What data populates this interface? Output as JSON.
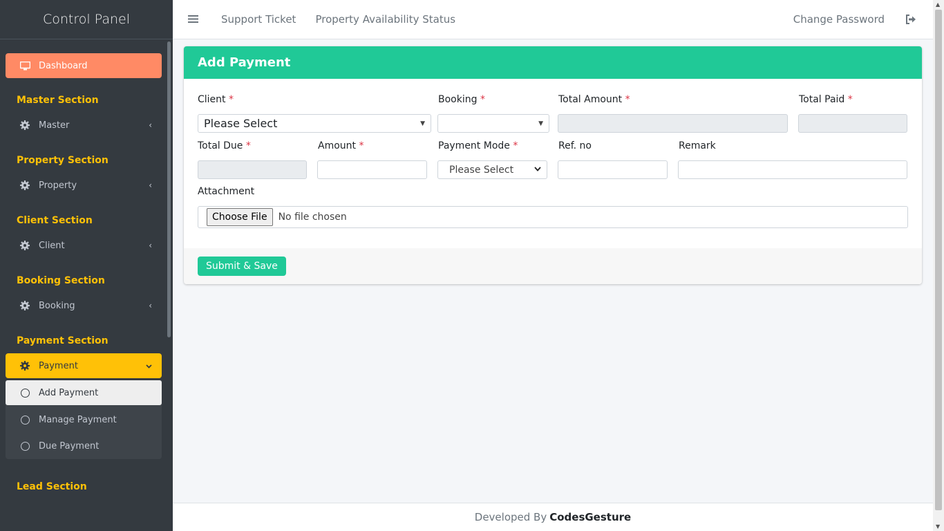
{
  "sidebar": {
    "brand": "Control Panel",
    "dashboard": "Dashboard",
    "sections": [
      {
        "header": "Master Section",
        "item": "Master"
      },
      {
        "header": "Property Section",
        "item": "Property"
      },
      {
        "header": "Client Section",
        "item": "Client"
      },
      {
        "header": "Booking Section",
        "item": "Booking"
      }
    ],
    "payment_header": "Payment Section",
    "payment_item": "Payment",
    "payment_sub": [
      "Add Payment",
      "Manage Payment",
      "Due Payment"
    ],
    "lead_header": "Lead Section"
  },
  "topnav": {
    "support": "Support Ticket",
    "availability": "Property Availability Status",
    "change_password": "Change Password"
  },
  "card": {
    "title": "Add Payment",
    "labels": {
      "client": "Client",
      "booking": "Booking",
      "total_amount": "Total Amount",
      "total_paid": "Total Paid",
      "total_due": "Total Due",
      "amount": "Amount",
      "payment_mode": "Payment Mode",
      "ref_no": "Ref. no",
      "remark": "Remark",
      "attachment": "Attachment"
    },
    "required_mark": "*",
    "client_value": "Please Select",
    "booking_value": "",
    "payment_mode_value": "Please Select",
    "file_button": "Choose File",
    "file_status": "No file chosen",
    "submit": "Submit & Save"
  },
  "footer": {
    "prefix": "Developed By",
    "brand": "CodesGesture"
  },
  "colors": {
    "sidebar_bg": "#343a40",
    "accent_green": "#20c997",
    "section_yellow": "#ffc107",
    "dashboard_orange": "#ff8a65"
  }
}
